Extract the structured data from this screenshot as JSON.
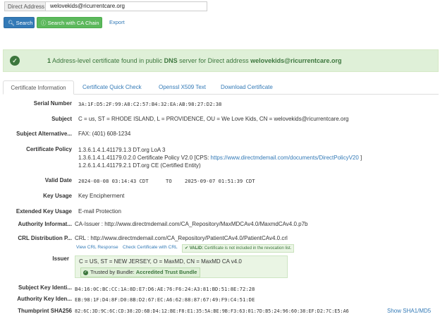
{
  "search": {
    "label": "Direct Address",
    "value": "welovekids@ricurrentcare.org",
    "search_button": "Search",
    "ca_chain_button": "Search with CA Chain",
    "export_link": "Export"
  },
  "alert": {
    "count": "1",
    "text_mid": " Address-level certificate found in public ",
    "dns": "DNS",
    "text_tail": " server for Direct address ",
    "address": "welovekids@ricurrentcare.org"
  },
  "tabs": [
    {
      "label": "Certificate Information",
      "active": true
    },
    {
      "label": "Certificate Quick Check"
    },
    {
      "label": "Openssl X509 Text"
    },
    {
      "label": "Download Certificate"
    }
  ],
  "cert": {
    "serial_label": "Serial Number",
    "serial": "3A:1F:D5:2F:99:A8:C2:57:B4:32:EA:AB:98:27:D2:38",
    "subject_label": "Subject",
    "subject": "C = us, ST = RHODE ISLAND, L = PROVIDENCE, OU = We Love Kids, CN = welovekids@ricurrentcare.org",
    "san_label": "Subject Alternative...",
    "san": "FAX: (401) 608-1234",
    "policy_label": "Certificate Policy",
    "policy_1": "1.3.6.1.4.1.41179.1.3  DT.org LoA 3",
    "policy_2_prefix": "1.3.6.1.4.1.41179.0.2.0  Certificate Policy V2.0  [CPS: ",
    "policy_2_link": "https://www.directmdemail.com/documents/DirectPolicyV20",
    "policy_2_suffix": " ]",
    "policy_3": "1.2.6.1.4.1.41179.2.1  DT.org CE (Certified Entity)",
    "valid_label": "Valid Date",
    "valid_from": "2024-08-08 03:14:43 CDT",
    "valid_to_word": "TO",
    "valid_to": "2025-09-07 01:51:39 CDT",
    "key_usage_label": "Key Usage",
    "key_usage": "Key Encipherment",
    "ext_key_usage_label": "Extended Key Usage",
    "ext_key_usage": "E-mail Protection",
    "aia_label": "Authority Informat...",
    "aia": "CA-Issuer : http://www.directmdemail.com/CA_Repository/MaxMDCAv4.0/MaxmdCAv4.0.p7b",
    "crl_label": "CRL Distribution P...",
    "crl": "CRL : http://www.directmdemail.com/CA_Repository/PatientCAv4.0/PatientCAv4.0.crl",
    "view_crl": "View CRL Response",
    "check_crl": "Check Certificate with CRL",
    "valid_badge_strong": "VALID:",
    "valid_badge_text": " Certificate is not included in the revocation list.",
    "issuer_label": "Issuer",
    "issuer": "C = US, ST = NEW JERSEY, O = MaxMD, CN = MaxMD CA v4.0",
    "trusted_prefix": "Trusted by Bundle: ",
    "trusted_bundle": "Accredited Trust Bundle",
    "ski_label": "Subject Key Identi...",
    "ski": "B4:16:0C:BC:CC:1A:8D:E7:D6:AE:76:F6:24:A3:81:BD:51:8E:72:28",
    "aki_label": "Authority Key Iden...",
    "aki": "EB:98:1F:D4:8F:D0:8B:D2:67:EC:A6:62:88:87:67:49:F9:C4:51:DE",
    "thumb_label": "Thumbprint SHA256",
    "thumb": "82:6C:3D:9C:6C:CD:38:2D:6B:D4:12:BE:F8:E1:35:5A:BE:9B:F3:63:01:7D:B5:24:96:60:38:EF:D2:7C:E5:A6",
    "show_sha1": "Show SHA1/MD5"
  },
  "colors": {
    "primary": "#337ab7",
    "success": "#5cb85c",
    "alert_bg": "#dff0d8",
    "alert_text": "#3c763d"
  }
}
